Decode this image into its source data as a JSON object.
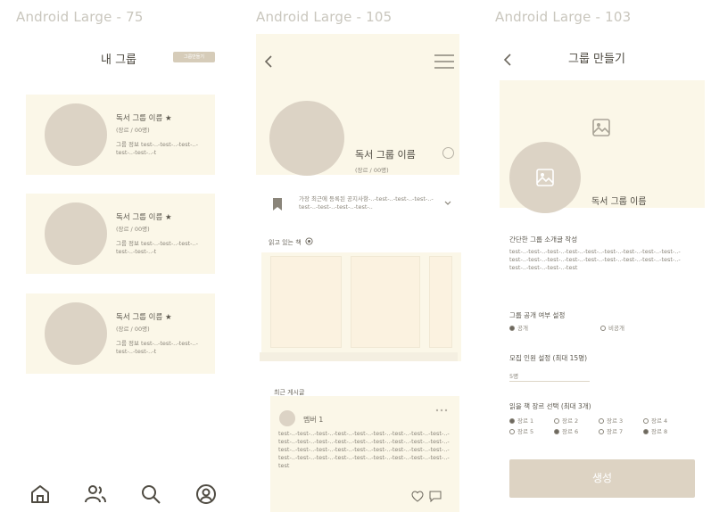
{
  "frames": [
    {
      "label": "Android Large - 75"
    },
    {
      "label": "Android Large - 105"
    },
    {
      "label": "Android Large - 103"
    }
  ],
  "screen1": {
    "title": "내 그룹",
    "header_button_label": "그룹만들기",
    "groups": [
      {
        "name": "독서 그룹 이름 ★",
        "meta": "(장르 / 00명)",
        "description": "그룹 정보 test-..-test-..-test-..-test-..-test-..-t"
      },
      {
        "name": "독서 그룹 이름 ★",
        "meta": "(장르 / 00명)",
        "description": "그룹 정보 test-..-test-..-test-..-test-..-test-..-t"
      },
      {
        "name": "독서 그룹 이름 ★",
        "meta": "(장르 / 00명)",
        "description": "그룹 정보 test-..-test-..-test-..-test-..-test-..-t"
      }
    ],
    "nav": [
      "home-icon",
      "people-icon",
      "search-icon",
      "profile-icon"
    ]
  },
  "screen2": {
    "group_name": "독서 그룹 이름",
    "group_meta": "(장르 / 00명)",
    "notice": "가장 최근에 등록된 공지사항-..-test-..-test-..-test-..-test-..-test-..-test-..-test-..",
    "reading_label": "읽고 있는 책",
    "recent_posts_label": "최근 게시글",
    "post": {
      "author": "멤버 1",
      "text": "test-..-test-..-test-..-test-..-test-..-test-..-test-..-test-..-test-..-test-..-test-..-test-..-test-..-test-..-test-..-test-..-test-..-test-..-test-..-test-..-test-..-test-..-test-..-test-..-test-..-test-..-test-..-test-..-test-..-test-..-test-..-test-..-test-..-test-..-test-..-test-..-test"
    }
  },
  "screen3": {
    "title": "그룹 만들기",
    "group_name": "독서 그룹 이름",
    "intro_label": "간단한 그룹 소개글 작성",
    "intro_text": "test-..-test-..-test-..-test-..-test-..-test-..-test-..-test-..-test-..-test-..-test-..-test-..-test-..-test-..-test-..-test-..-test-..-test-..-test-..-test-..-test-..-test",
    "visibility_label": "그룹 공개 여부 설정",
    "visibility_options": [
      "공개",
      "비공개"
    ],
    "visibility_selected": "공개",
    "member_limit_label": "모집 인원 설정 (최대 15명)",
    "member_limit_value": "5명",
    "genre_label": "읽을 책 장르 선택 (최대 3개)",
    "genres": [
      {
        "label": "장르 1",
        "selected": true
      },
      {
        "label": "장르 2",
        "selected": false
      },
      {
        "label": "장르 3",
        "selected": false
      },
      {
        "label": "장르 4",
        "selected": false
      },
      {
        "label": "장르 5",
        "selected": false
      },
      {
        "label": "장르 6",
        "selected": true
      },
      {
        "label": "장르 7",
        "selected": false
      },
      {
        "label": "장르 8",
        "selected": true
      }
    ],
    "create_button": "생성"
  },
  "colors": {
    "card_bg": "#fbf7e8",
    "avatar": "#dcd3c5",
    "button": "#ddd3c3",
    "frame_label": "#c9c6bd"
  }
}
